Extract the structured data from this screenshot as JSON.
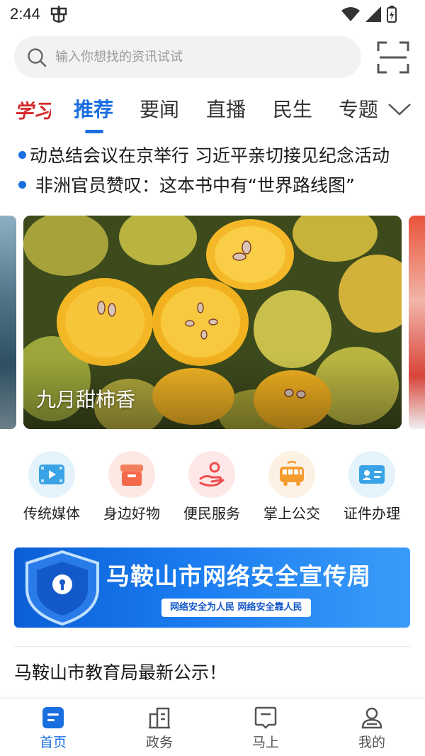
{
  "status_bar": {
    "time": "2:44"
  },
  "search": {
    "placeholder": "输入你想找的资讯试试"
  },
  "tabs": [
    {
      "label": "推荐",
      "active": true
    },
    {
      "label": "要闻"
    },
    {
      "label": "直播"
    },
    {
      "label": "民生"
    },
    {
      "label": "专题"
    }
  ],
  "headlines": [
    "动总结会议在京举行  习近平亲切接见纪念活动",
    "非洲官员赞叹：这本书中有“世界路线图”"
  ],
  "carousel": {
    "caption": "九月甜柿香"
  },
  "services": [
    {
      "label": "传统媒体",
      "icon": "tv-media-icon"
    },
    {
      "label": "身边好物",
      "icon": "shop-icon"
    },
    {
      "label": "便民服务",
      "icon": "hand-service-icon"
    },
    {
      "label": "掌上公交",
      "icon": "bus-icon"
    },
    {
      "label": "证件办理",
      "icon": "id-card-icon"
    }
  ],
  "banner": {
    "title": "马鞍山市网络安全宣传周",
    "subtitle": "网络安全为人民 网络安全靠人民"
  },
  "article": {
    "title": "马鞍山市教育局最新公示！"
  },
  "bottom_nav": [
    {
      "label": "首页",
      "active": true
    },
    {
      "label": "政务"
    },
    {
      "label": "马上"
    },
    {
      "label": "我的"
    }
  ],
  "colors": {
    "accent": "#1a6fe0"
  }
}
